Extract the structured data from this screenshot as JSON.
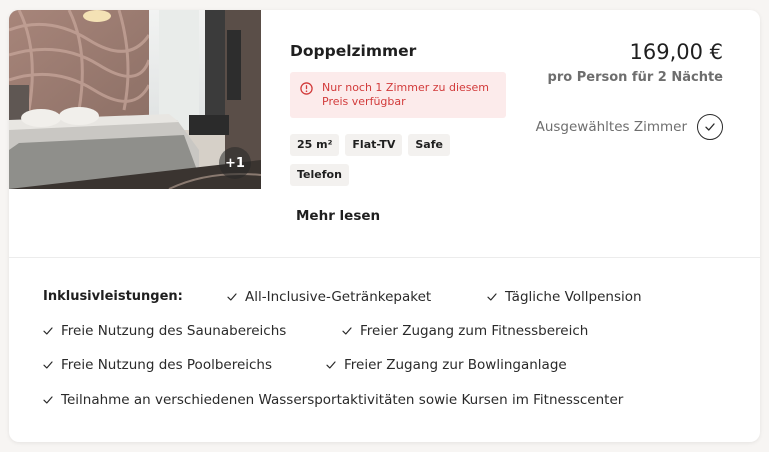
{
  "room": {
    "title": "Doppelzimmer",
    "photo_extra_count": "+1",
    "availability_alert": "Nur noch 1 Zimmer zu diesem Preis verfügbar",
    "amenities": [
      "25 m²",
      "Flat-TV",
      "Safe",
      "Telefon"
    ],
    "more_link": "Mehr lesen"
  },
  "pricing": {
    "price": "169,00 €",
    "note": "pro Person für 2 Nächte"
  },
  "selection": {
    "label": "Ausgewähltes Zimmer",
    "selected": true
  },
  "inclusions": {
    "heading": "Inklusivleistungen:",
    "items": [
      "All-Inclusive-Getränkepaket",
      "Tägliche Vollpension",
      "Freie Nutzung des Saunabereichs",
      "Freier Zugang zum Fitnessbereich",
      "Freie Nutzung des Poolbereichs",
      "Freier Zugang zur Bowlinganlage",
      "Teilnahme an verschiedenen Wassersportaktivitäten sowie Kursen im Fitnesscenter"
    ]
  },
  "colors": {
    "alert_bg": "#fcebeb",
    "alert_text": "#d23b3b",
    "tag_bg": "#f3f1ef",
    "muted_text": "#6e6e6e"
  },
  "icons": {
    "alert": "alert-circle-icon",
    "selected": "check-circle-icon",
    "inclusion": "checkmark-icon"
  }
}
